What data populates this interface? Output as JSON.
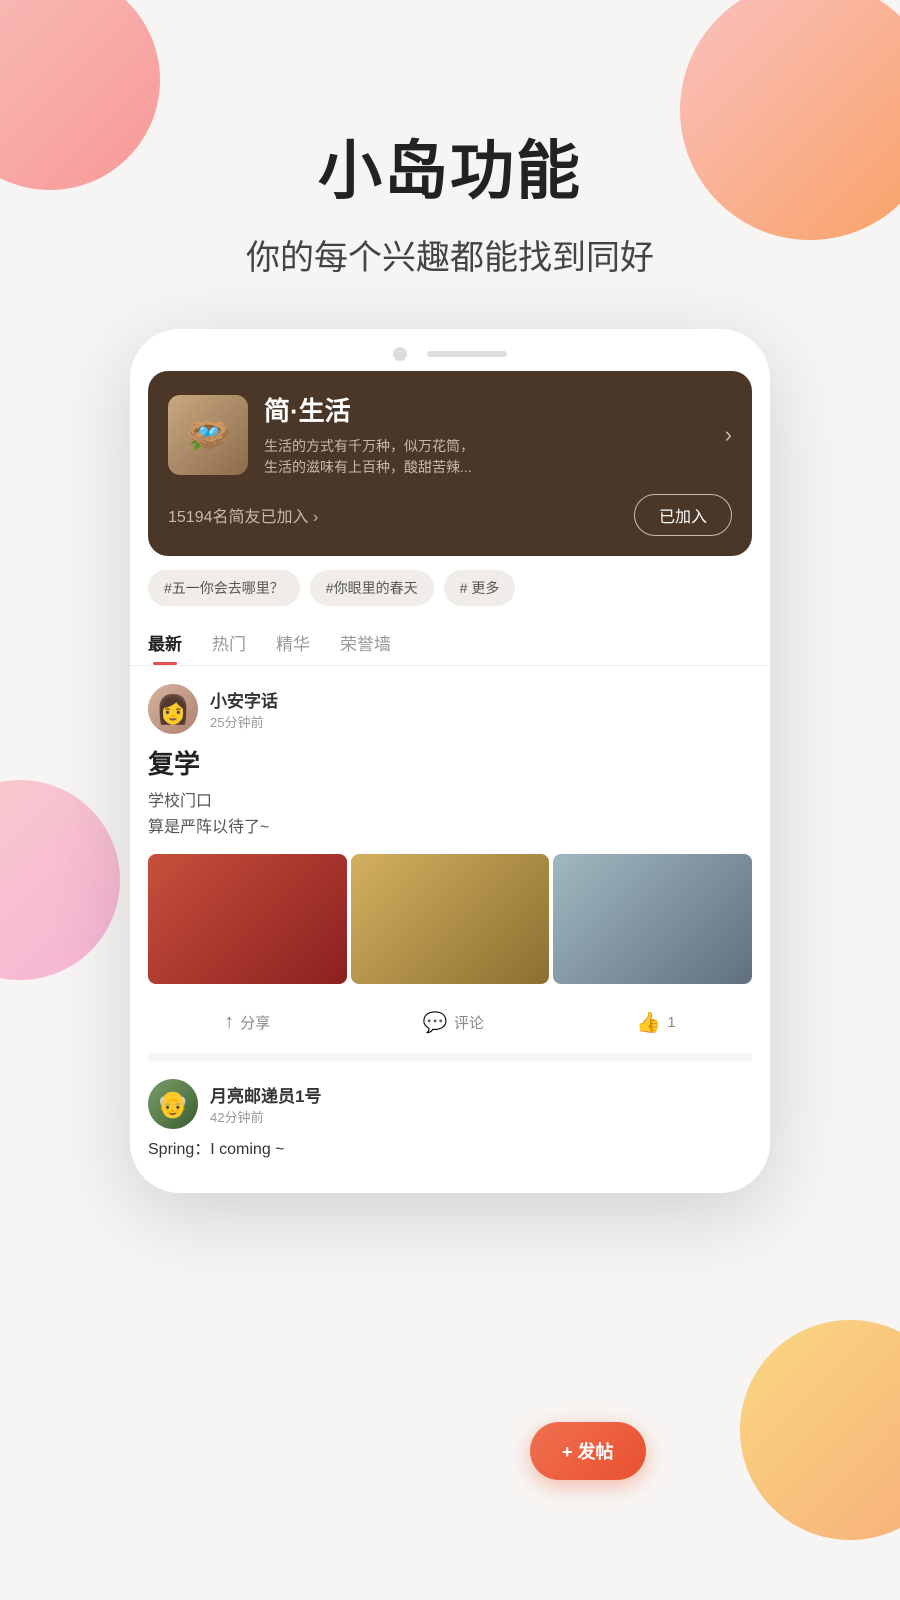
{
  "page": {
    "title": "小岛功能",
    "subtitle": "你的每个兴趣都能找到同好"
  },
  "island": {
    "name": "简·生活",
    "desc_line1": "生活的方式有千万种，似万花筒，",
    "desc_line2": "生活的滋味有上百种，酸甜苦辣...",
    "member_count": "15194名简友已加入 ›",
    "join_btn": "已加入",
    "tags": [
      "#五一你会去哪里？",
      "#你眼里的春天",
      "#",
      "更多"
    ]
  },
  "tabs": [
    "最新",
    "热门",
    "精华",
    "荣誉墙"
  ],
  "post1": {
    "author": "小安字话",
    "time": "25分钟前",
    "title": "复学",
    "line1": "学校门口",
    "line2": "算是严阵以待了~",
    "share": "分享",
    "comment": "评论",
    "like": "1"
  },
  "post2": {
    "author": "月亮邮递员1号",
    "time": "42分钟前",
    "content": "Spring：I coming ~"
  },
  "fab": "+ 发帖"
}
